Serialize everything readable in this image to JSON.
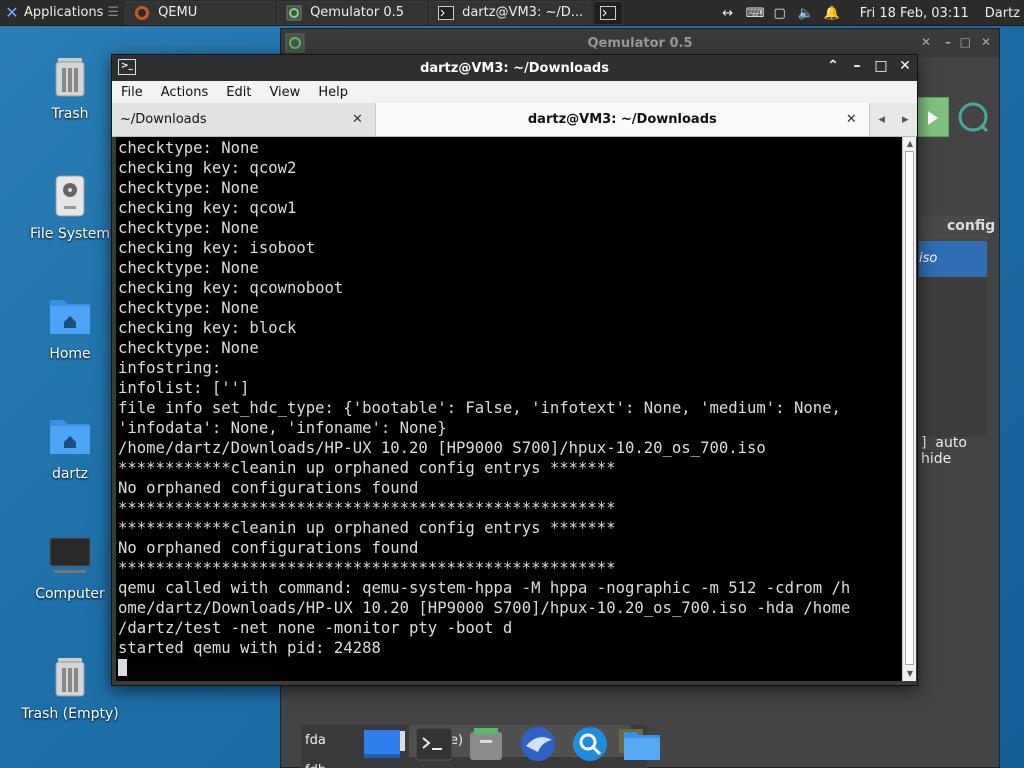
{
  "top_panel": {
    "applications_label": "Applications",
    "tasks": [
      {
        "label": "QEMU",
        "icon": "qemu-icon"
      },
      {
        "label": "Qemulator 0.5",
        "icon": "qemulator-icon"
      },
      {
        "label": "dartz@VM3: ~/D...",
        "icon": "terminal-icon"
      },
      {
        "label": "",
        "icon": "terminal-icon"
      }
    ],
    "clock": "Fri 18 Feb, 03:11",
    "user": "Dartz"
  },
  "desktop_icons": [
    {
      "label": "Trash",
      "icon": "trash-icon"
    },
    {
      "label": "File System",
      "icon": "drive-icon"
    },
    {
      "label": "Home",
      "icon": "home-folder-icon"
    },
    {
      "label": "dartz",
      "icon": "home-folder-icon"
    },
    {
      "label": "Computer",
      "icon": "computer-icon"
    },
    {
      "label": "Trash (Empty)",
      "icon": "trash-icon"
    }
  ],
  "qemulator": {
    "title": "Qemulator 0.5",
    "config_header": "config",
    "selected_item": "iso",
    "auto_hide_label": "auto hide",
    "fda_label": "fda",
    "fdb_label": "fdb",
    "fda_value": "(None)"
  },
  "terminal": {
    "title": "dartz@VM3: ~/Downloads",
    "menu": [
      "File",
      "Actions",
      "Edit",
      "View",
      "Help"
    ],
    "tabs": [
      {
        "label": "~/Downloads",
        "active": false
      },
      {
        "label": "dartz@VM3: ~/Downloads",
        "active": true
      }
    ],
    "lines": [
      "checktype: None",
      "checking key: qcow2",
      "checktype: None",
      "checking key: qcow1",
      "checktype: None",
      "checking key: isoboot",
      "checktype: None",
      "checking key: qcownoboot",
      "checktype: None",
      "checking key: block",
      "checktype: None",
      "infostring:",
      "infolist: ['']",
      "file info set_hdc_type: {'bootable': False, 'infotext': None, 'medium': None,",
      "'infodata': None, 'infoname': None}",
      "/home/dartz/Downloads/HP-UX 10.20 [HP9000 S700]/hpux-10.20_os_700.iso",
      "************cleanin up orphaned config entrys *******",
      "No orphaned configurations found",
      "*****************************************************",
      "************cleanin up orphaned config entrys *******",
      "No orphaned configurations found",
      "*****************************************************",
      "qemu called with command: qemu-system-hppa -M hppa -nographic -m 512 -cdrom /h",
      "ome/dartz/Downloads/HP-UX 10.20 [HP9000 S700]/hpux-10.20_os_700.iso -hda /home",
      "/dartz/test -net none -monitor pty -boot d",
      "started qemu with pid: 24288"
    ]
  },
  "dock": [
    {
      "icon": "show-desktop-icon"
    },
    {
      "icon": "terminal-icon"
    },
    {
      "icon": "file-manager-icon"
    },
    {
      "icon": "web-browser-icon"
    },
    {
      "icon": "search-icon"
    },
    {
      "icon": "folder-icon"
    }
  ]
}
